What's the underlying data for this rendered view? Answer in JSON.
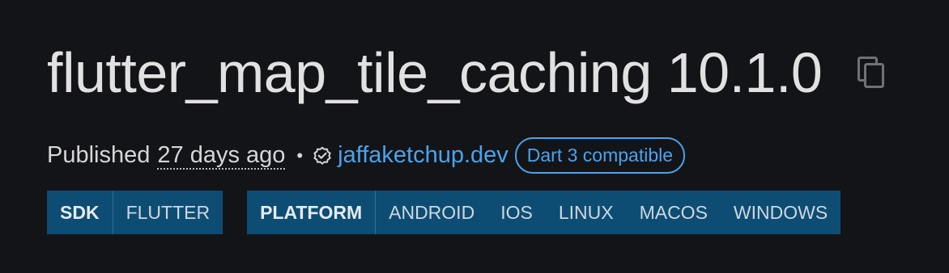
{
  "package": {
    "title": "flutter_map_tile_caching 10.1.0",
    "copy_icon": "copy-icon"
  },
  "meta": {
    "published_label": "Published",
    "published_date": "27 days ago",
    "bullet": "•",
    "verified_icon": "verified-publisher-icon",
    "publisher": "jaffaketchup.dev",
    "dart3_badge": "Dart 3 compatible"
  },
  "tags": {
    "sdk": {
      "label": "SDK",
      "values": [
        "FLUTTER"
      ]
    },
    "platform": {
      "label": "PLATFORM",
      "values": [
        "ANDROID",
        "IOS",
        "LINUX",
        "MACOS",
        "WINDOWS"
      ]
    }
  },
  "colors": {
    "background": "#131418",
    "link": "#4aa3ec",
    "tag_background": "#0d4d74"
  }
}
